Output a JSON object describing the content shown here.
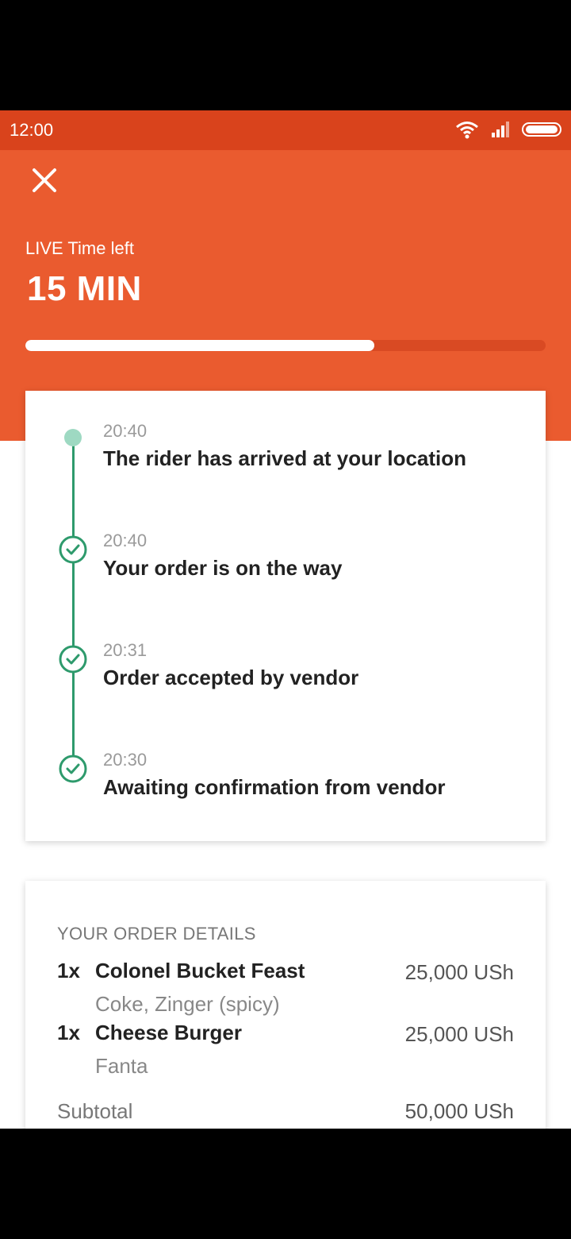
{
  "status_bar": {
    "time": "12:00"
  },
  "header": {
    "live_label": "LIVE Time left",
    "time_left": "15 MIN",
    "progress": 0.67,
    "color": "#ea5b2f"
  },
  "timeline": [
    {
      "time": "20:40",
      "title": "The rider has arrived at your location",
      "state": "current"
    },
    {
      "time": "20:40",
      "title": "Your order is on the way",
      "state": "done"
    },
    {
      "time": "20:31",
      "title": "Order accepted by vendor",
      "state": "done"
    },
    {
      "time": "20:30",
      "title": "Awaiting confirmation from vendor",
      "state": "done"
    }
  ],
  "order": {
    "section_title": "YOUR ORDER DETAILS",
    "items": [
      {
        "qty": "1x",
        "name": "Colonel Bucket Feast",
        "price": "25,000 USh",
        "options": "Coke, Zinger (spicy)"
      },
      {
        "qty": "1x",
        "name": "Cheese Burger",
        "price": "25,000 USh",
        "options": "Fanta"
      }
    ],
    "subtotal_label": "Subtotal",
    "subtotal_value": "50,000 USh"
  },
  "colors": {
    "accent": "#ea5b2f",
    "status_bar": "#d9431c",
    "timeline_green": "#2e9a6c"
  },
  "icons": {
    "close": "close-icon",
    "wifi": "wifi-icon",
    "signal": "signal-icon",
    "battery": "battery-icon",
    "check": "check-circle-icon"
  }
}
